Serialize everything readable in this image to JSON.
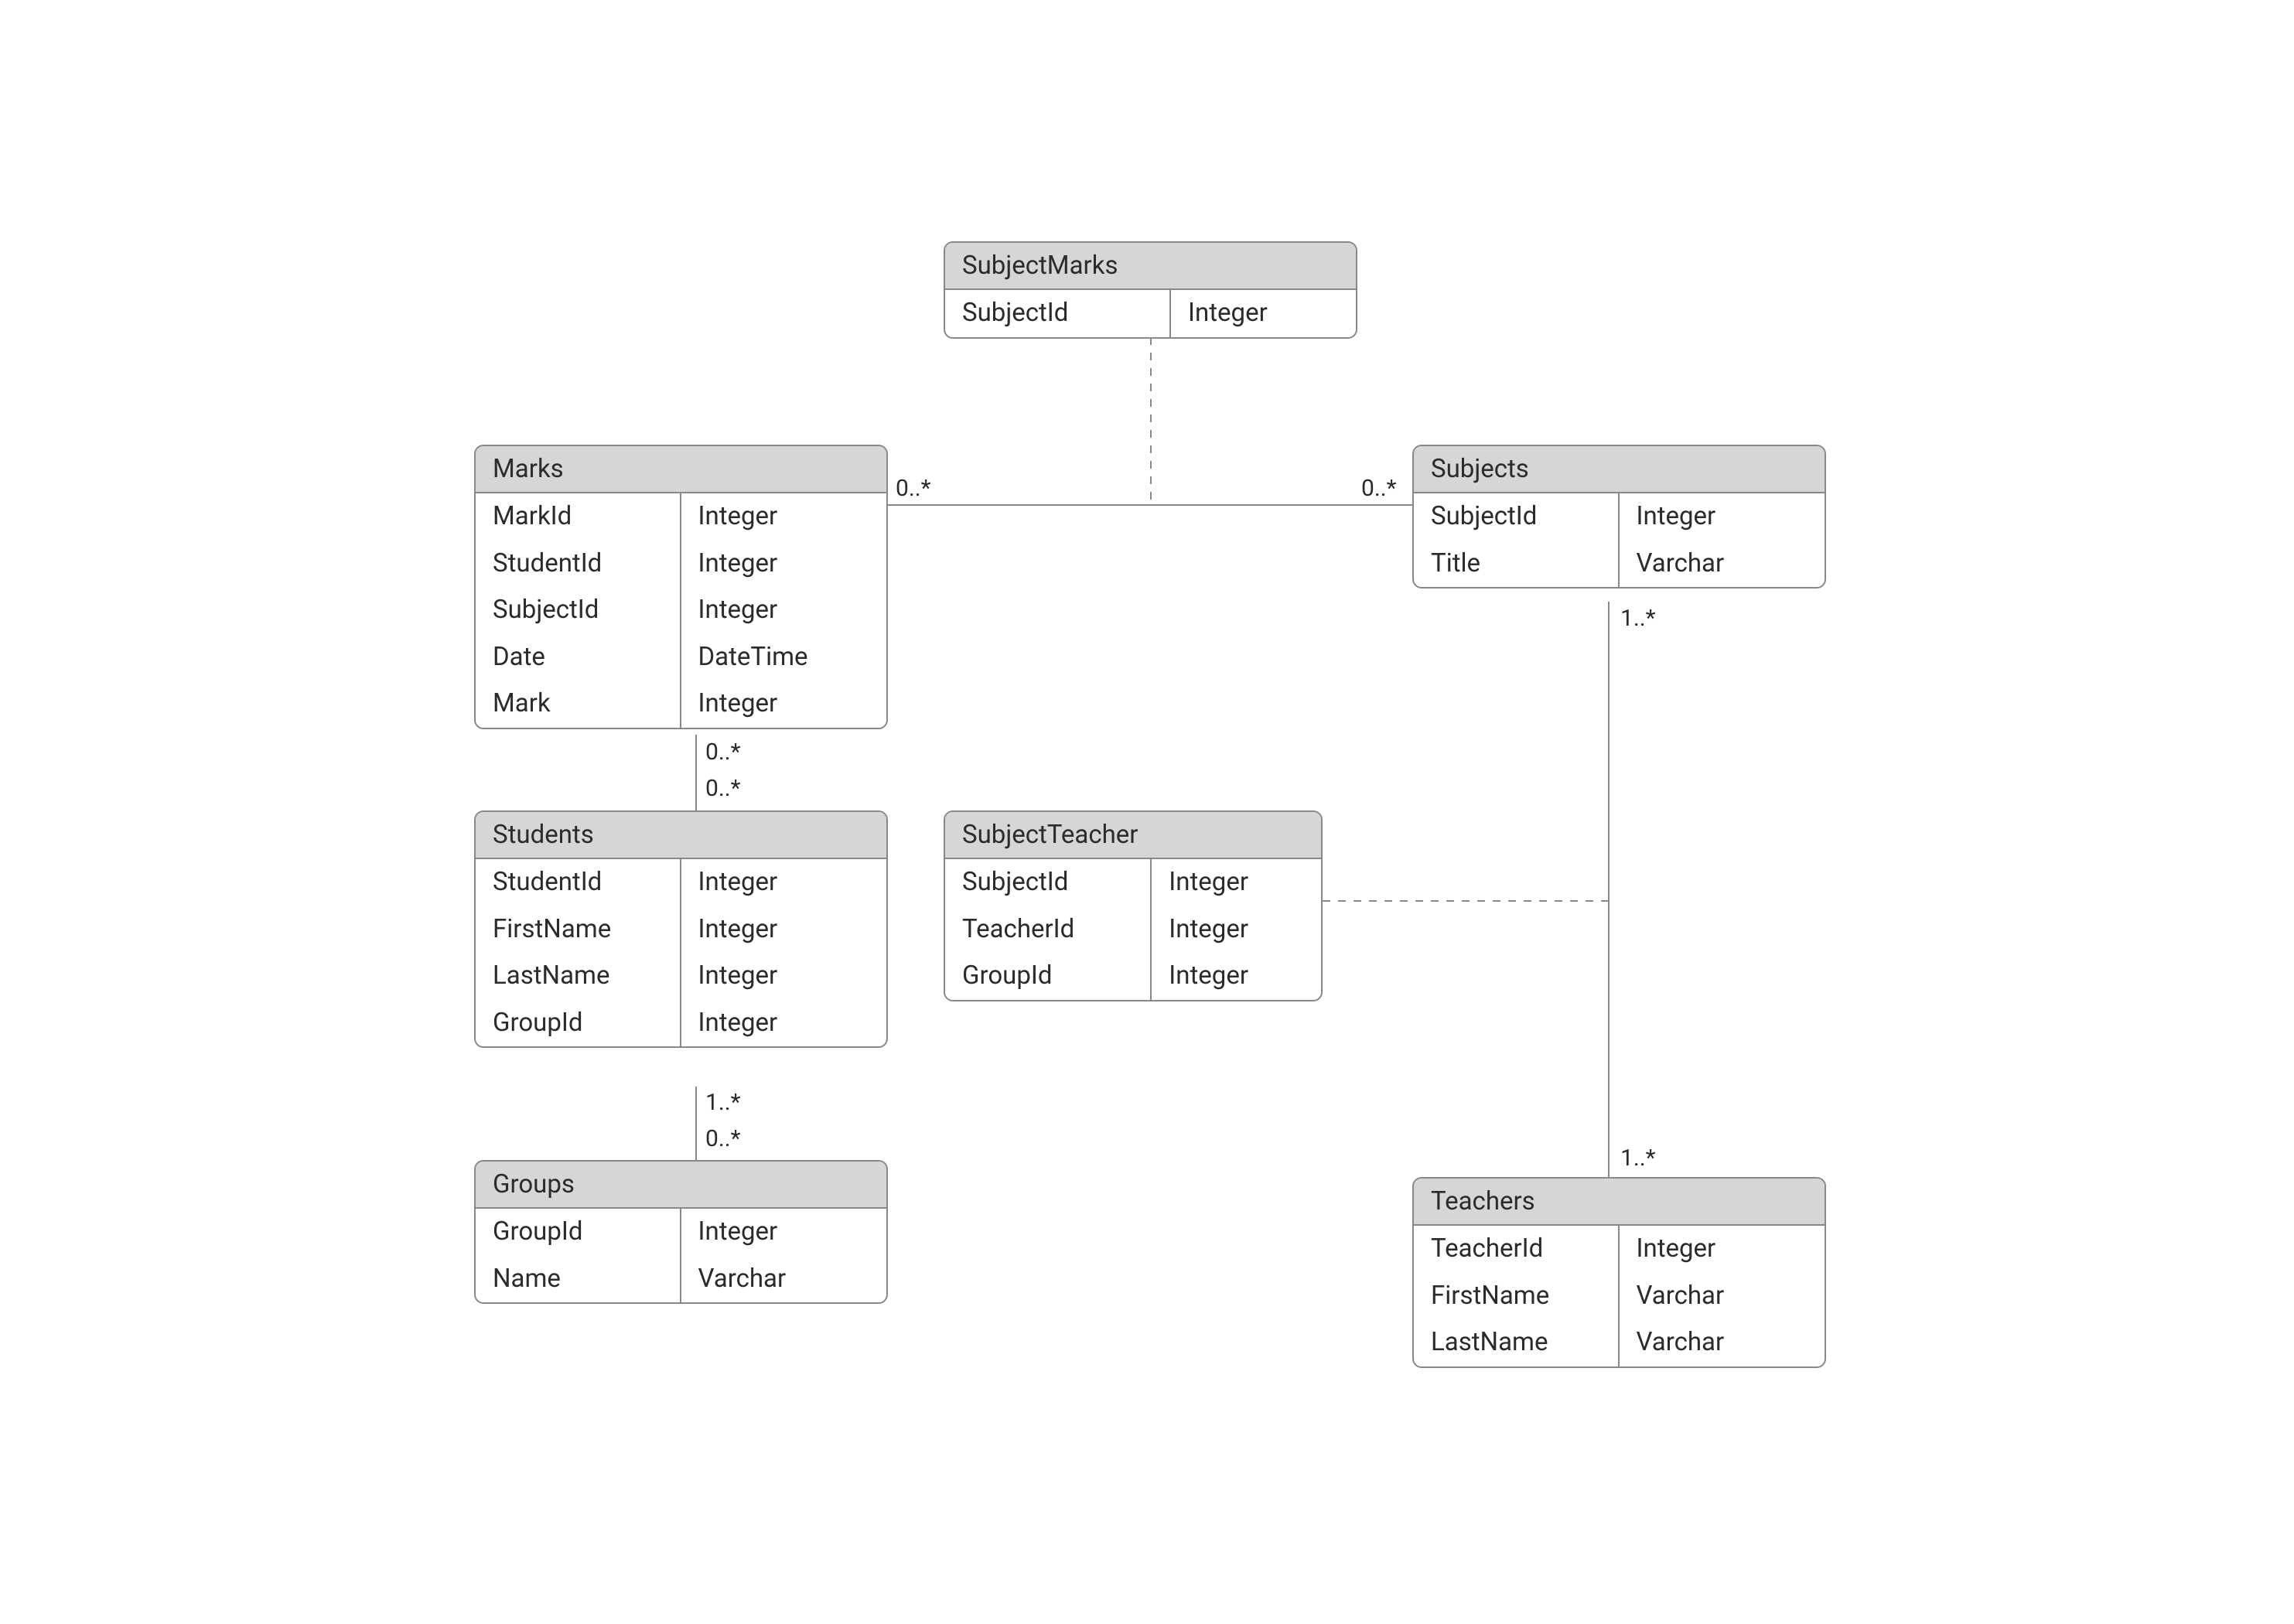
{
  "entities": {
    "subjectMarks": {
      "title": "SubjectMarks",
      "rows": [
        {
          "name": "SubjectId",
          "type": "Integer"
        }
      ]
    },
    "marks": {
      "title": "Marks",
      "rows": [
        {
          "name": "MarkId",
          "type": "Integer"
        },
        {
          "name": "StudentId",
          "type": "Integer"
        },
        {
          "name": "SubjectId",
          "type": "Integer"
        },
        {
          "name": "Date",
          "type": "DateTime"
        },
        {
          "name": "Mark",
          "type": "Integer"
        }
      ]
    },
    "subjects": {
      "title": "Subjects",
      "rows": [
        {
          "name": "SubjectId",
          "type": "Integer"
        },
        {
          "name": "Title",
          "type": "Varchar"
        }
      ]
    },
    "students": {
      "title": "Students",
      "rows": [
        {
          "name": "StudentId",
          "type": "Integer"
        },
        {
          "name": "FirstName",
          "type": "Integer"
        },
        {
          "name": "LastName",
          "type": "Integer"
        },
        {
          "name": "GroupId",
          "type": "Integer"
        }
      ]
    },
    "subjectTeacher": {
      "title": "SubjectTeacher",
      "rows": [
        {
          "name": "SubjectId",
          "type": "Integer"
        },
        {
          "name": "TeacherId",
          "type": "Integer"
        },
        {
          "name": "GroupId",
          "type": "Integer"
        }
      ]
    },
    "groups": {
      "title": "Groups",
      "rows": [
        {
          "name": "GroupId",
          "type": "Integer"
        },
        {
          "name": "Name",
          "type": "Varchar"
        }
      ]
    },
    "teachers": {
      "title": "Teachers",
      "rows": [
        {
          "name": "TeacherId",
          "type": "Integer"
        },
        {
          "name": "FirstName",
          "type": "Varchar"
        },
        {
          "name": "LastName",
          "type": "Varchar"
        }
      ]
    }
  },
  "multiplicities": {
    "marksSubjects_left": "0..*",
    "marksSubjects_right": "0..*",
    "subjects_teachers_top": "1..*",
    "subjects_teachers_bottom": "1..*",
    "marks_students_top": "0..*",
    "marks_students_bottom": "0..*",
    "students_groups_top": "1..*",
    "students_groups_bottom": "0..*"
  }
}
